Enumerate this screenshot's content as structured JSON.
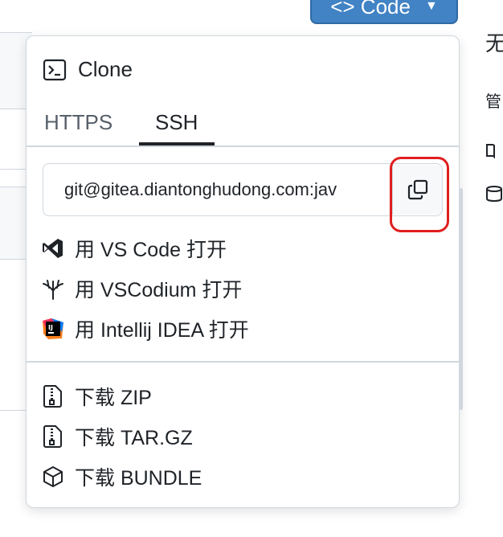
{
  "header": {
    "code_button_label": "<> Code"
  },
  "side": {
    "char_top": "无",
    "char_mid": "管"
  },
  "dropdown": {
    "title": "Clone",
    "tabs": [
      {
        "label": "HTTPS",
        "active": false
      },
      {
        "label": "SSH",
        "active": true
      }
    ],
    "clone_url": "git@gitea.diantonghudong.com:jav",
    "open_items": [
      {
        "label": "用 VS Code 打开",
        "icon": "vscode-icon"
      },
      {
        "label": "用 VSCodium 打开",
        "icon": "vscodium-icon"
      },
      {
        "label": "用 Intellij IDEA 打开",
        "icon": "intellij-icon"
      }
    ],
    "download_items": [
      {
        "label": "下载 ZIP",
        "icon": "file-zip-icon"
      },
      {
        "label": "下载 TAR.GZ",
        "icon": "file-zip-icon"
      },
      {
        "label": "下载 BUNDLE",
        "icon": "package-icon"
      }
    ]
  },
  "colors": {
    "accent": "#4183c4",
    "highlight": "#e01e1e",
    "border": "#d0d7de"
  }
}
